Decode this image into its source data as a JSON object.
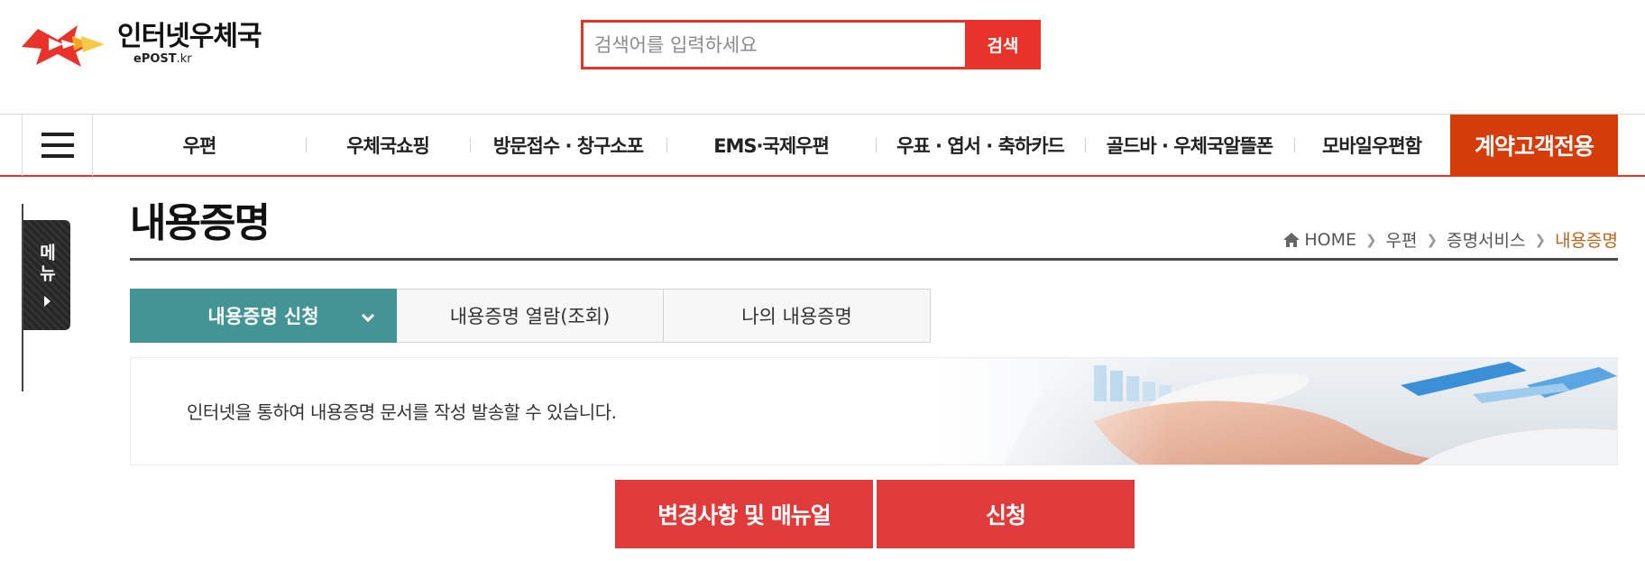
{
  "header": {
    "logo_name": "인터넷우체국",
    "logo_sub_main": "ePOST",
    "logo_sub_kr": ".kr"
  },
  "search": {
    "placeholder": "검색어를 입력하세요",
    "value": "",
    "button_label": "검색"
  },
  "nav": {
    "items": [
      {
        "label": "우편"
      },
      {
        "label": "우체국쇼핑"
      },
      {
        "label": "방문접수 · 창구소포"
      },
      {
        "label": "EMS·국제우편"
      },
      {
        "label": "우표 · 엽서 · 축하카드"
      },
      {
        "label": "골드바 · 우체국알뜰폰"
      },
      {
        "label": "모바일우편함"
      }
    ],
    "special": "계약고객전용"
  },
  "side_menu": {
    "label": "메뉴"
  },
  "page": {
    "title": "내용증명"
  },
  "breadcrumb": [
    "HOME",
    "우편",
    "증명서비스",
    "내용증명"
  ],
  "tabs": [
    {
      "label": "내용증명 신청",
      "active": true
    },
    {
      "label": "내용증명 열람(조회)",
      "active": false
    },
    {
      "label": "나의 내용증명",
      "active": false
    }
  ],
  "banner": {
    "text": "인터넷을 통하여 내용증명 문서를 작성 발송할 수 있습니다."
  },
  "actions": {
    "manual_label": "변경사항 및 매뉴얼",
    "apply_label": "신청"
  },
  "colors": {
    "brand_red": "#e8332a",
    "contract_orange": "#d43c0a",
    "tab_teal": "#439494",
    "action_red": "#e03b3b",
    "breadcrumb_current": "#b5651d"
  },
  "icons": [
    "menu-icon",
    "home-icon",
    "chevron-down-icon",
    "chevron-right-icon"
  ]
}
